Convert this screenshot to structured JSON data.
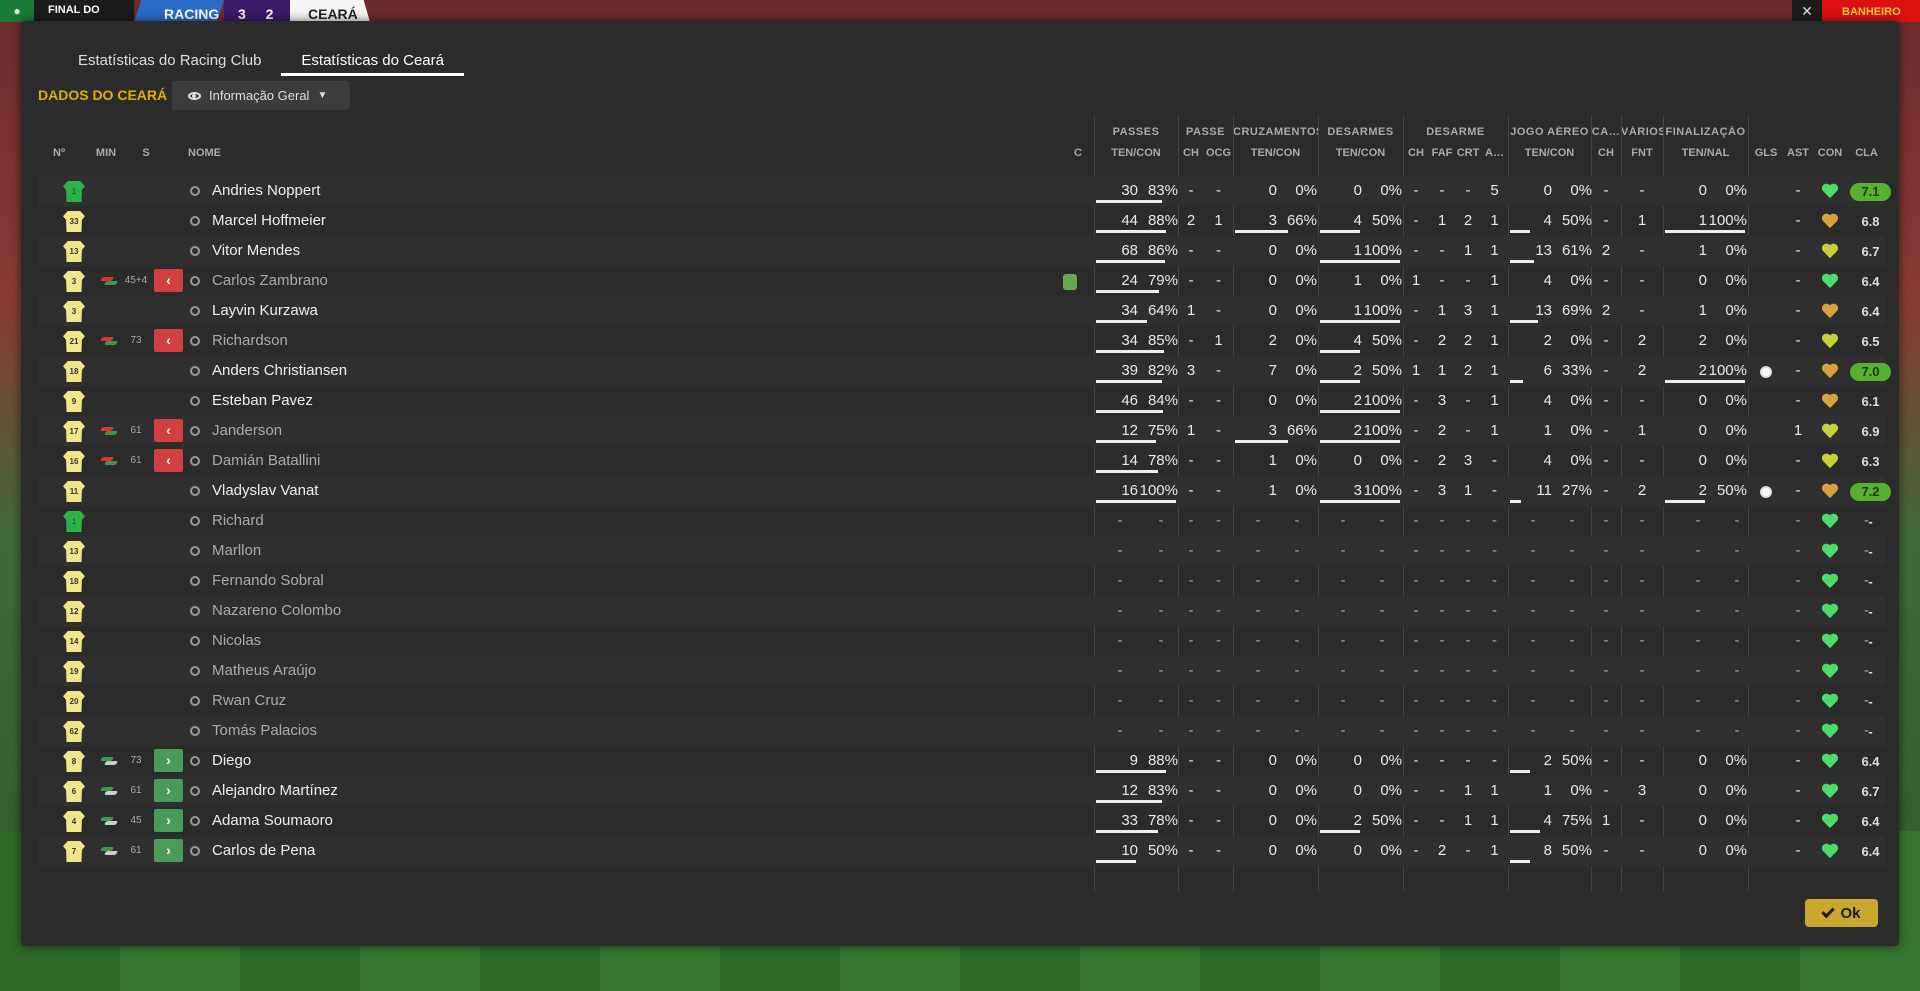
{
  "scorebar": {
    "stage": "FINAL DO",
    "home": "RACING",
    "score": "3 2",
    "away": "CEARÁ",
    "right_label": "BANHEIRO"
  },
  "tabs": [
    {
      "label": "Estatísticas do Racing Club",
      "active": false
    },
    {
      "label": "Estatísticas do Ceará",
      "active": true
    }
  ],
  "section_label": "DADOS DO CEARÁ",
  "view_select": "Informação Geral",
  "ok_label": "Ok",
  "group_headers": [
    "PASSES",
    "PASSE",
    "CRUZAMENTOS",
    "DESARMES",
    "DESARME",
    "JOGO AÉREO",
    "CA…",
    "VÁRIOS",
    "FINALIZAÇÃO"
  ],
  "column_headers": [
    "Nº",
    "MIN",
    "S",
    "NOME",
    "C",
    "TEN/CON",
    "CH",
    "OCG",
    "TEN/CON",
    "TEN/CON",
    "CH",
    "FAF",
    "CRT",
    "A…",
    "TEN/CON",
    "CH",
    "FNT",
    "TEN/NAL",
    "GLS",
    "AST",
    "CON",
    "CLA"
  ],
  "colors": {
    "accent": "#e0b000",
    "ok": "#c9a830",
    "sub_out": "#d04040",
    "sub_in": "#4a9a5a",
    "best_rating": "#58b030"
  },
  "players": [
    {
      "num": "1",
      "gk": true,
      "sub": "",
      "min": "",
      "name": "Andries Noppert",
      "pas": [
        "30",
        "83%"
      ],
      "pasf": 0.83,
      "pch": "-",
      "ocg": "-",
      "cru": [
        "0",
        "0%"
      ],
      "cruf": 0,
      "des": [
        "0",
        "0%"
      ],
      "desf": 0,
      "dch": "-",
      "faf": "-",
      "crt": "-",
      "a": "5",
      "air": [
        "0",
        "0%"
      ],
      "airf": 0,
      "ca": "-",
      "fnt": "-",
      "fin": [
        "0",
        "0%"
      ],
      "finf": 0,
      "gls": "",
      "ast": "-",
      "con": "green",
      "cla": "7.1",
      "best": true,
      "dim": false
    },
    {
      "num": "33",
      "gk": false,
      "sub": "",
      "min": "",
      "name": "Marcel Hoffmeier",
      "pas": [
        "44",
        "88%"
      ],
      "pasf": 0.88,
      "pch": "2",
      "ocg": "1",
      "cru": [
        "3",
        "66%"
      ],
      "cruf": 0.66,
      "des": [
        "4",
        "50%"
      ],
      "desf": 0.5,
      "dch": "-",
      "faf": "1",
      "crt": "2",
      "a": "1",
      "air": [
        "4",
        "50%"
      ],
      "airf": 0.5,
      "ca": "-",
      "fnt": "1",
      "fin": [
        "1",
        "100%"
      ],
      "finf": 1,
      "gls": "",
      "ast": "-",
      "con": "orange",
      "cla": "6.8",
      "best": false,
      "dim": false
    },
    {
      "num": "13",
      "gk": false,
      "sub": "",
      "min": "",
      "name": "Vitor Mendes",
      "pas": [
        "68",
        "86%"
      ],
      "pasf": 0.86,
      "pch": "-",
      "ocg": "-",
      "cru": [
        "0",
        "0%"
      ],
      "cruf": 0,
      "des": [
        "1",
        "100%"
      ],
      "desf": 1,
      "dch": "-",
      "faf": "-",
      "crt": "1",
      "a": "1",
      "air": [
        "13",
        "61%"
      ],
      "airf": 0.61,
      "ca": "2",
      "fnt": "-",
      "fin": [
        "1",
        "0%"
      ],
      "finf": 0,
      "gls": "",
      "ast": "-",
      "con": "yellow",
      "cla": "6.7",
      "best": false,
      "dim": false
    },
    {
      "num": "3",
      "gk": false,
      "sub": "out",
      "min": "45+4",
      "name": "Carlos Zambrano",
      "pas": [
        "24",
        "79%"
      ],
      "pasf": 0.79,
      "pch": "-",
      "ocg": "-",
      "cru": [
        "0",
        "0%"
      ],
      "cruf": 0,
      "des": [
        "1",
        "0%"
      ],
      "desf": 0,
      "dch": "1",
      "faf": "-",
      "crt": "-",
      "a": "1",
      "air": [
        "4",
        "0%"
      ],
      "airf": 0,
      "ca": "-",
      "fnt": "-",
      "fin": [
        "0",
        "0%"
      ],
      "finf": 0,
      "gls": "",
      "ast": "-",
      "con": "green",
      "cla": "6.4",
      "best": false,
      "dim": true,
      "card": true
    },
    {
      "num": "3",
      "gk": false,
      "sub": "",
      "min": "",
      "name": "Layvin Kurzawa",
      "pas": [
        "34",
        "64%"
      ],
      "pasf": 0.64,
      "pch": "1",
      "ocg": "-",
      "cru": [
        "0",
        "0%"
      ],
      "cruf": 0,
      "des": [
        "1",
        "100%"
      ],
      "desf": 1,
      "dch": "-",
      "faf": "1",
      "crt": "3",
      "a": "1",
      "air": [
        "13",
        "69%"
      ],
      "airf": 0.69,
      "ca": "2",
      "fnt": "-",
      "fin": [
        "1",
        "0%"
      ],
      "finf": 0,
      "gls": "",
      "ast": "-",
      "con": "orange",
      "cla": "6.4",
      "best": false,
      "dim": false
    },
    {
      "num": "21",
      "gk": false,
      "sub": "out",
      "min": "73",
      "name": "Richardson",
      "pas": [
        "34",
        "85%"
      ],
      "pasf": 0.85,
      "pch": "-",
      "ocg": "1",
      "cru": [
        "2",
        "0%"
      ],
      "cruf": 0,
      "des": [
        "4",
        "50%"
      ],
      "desf": 0.5,
      "dch": "-",
      "faf": "2",
      "crt": "2",
      "a": "1",
      "air": [
        "2",
        "0%"
      ],
      "airf": 0,
      "ca": "-",
      "fnt": "2",
      "fin": [
        "2",
        "0%"
      ],
      "finf": 0,
      "gls": "",
      "ast": "-",
      "con": "yellow",
      "cla": "6.5",
      "best": false,
      "dim": true
    },
    {
      "num": "18",
      "gk": false,
      "sub": "",
      "min": "",
      "name": "Anders Christiansen",
      "pas": [
        "39",
        "82%"
      ],
      "pasf": 0.82,
      "pch": "3",
      "ocg": "-",
      "cru": [
        "7",
        "0%"
      ],
      "cruf": 0,
      "des": [
        "2",
        "50%"
      ],
      "desf": 0.5,
      "dch": "1",
      "faf": "1",
      "crt": "2",
      "a": "1",
      "air": [
        "6",
        "33%"
      ],
      "airf": 0.33,
      "ca": "-",
      "fnt": "2",
      "fin": [
        "2",
        "100%"
      ],
      "finf": 1,
      "gls": "ball",
      "ast": "-",
      "con": "orange",
      "cla": "7.0",
      "best": true,
      "dim": false
    },
    {
      "num": "9",
      "gk": false,
      "sub": "",
      "min": "",
      "name": "Esteban Pavez",
      "pas": [
        "46",
        "84%"
      ],
      "pasf": 0.84,
      "pch": "-",
      "ocg": "-",
      "cru": [
        "0",
        "0%"
      ],
      "cruf": 0,
      "des": [
        "2",
        "100%"
      ],
      "desf": 1,
      "dch": "-",
      "faf": "3",
      "crt": "-",
      "a": "1",
      "air": [
        "4",
        "0%"
      ],
      "airf": 0,
      "ca": "-",
      "fnt": "-",
      "fin": [
        "0",
        "0%"
      ],
      "finf": 0,
      "gls": "",
      "ast": "-",
      "con": "orange",
      "cla": "6.1",
      "best": false,
      "dim": false
    },
    {
      "num": "17",
      "gk": false,
      "sub": "out",
      "min": "61",
      "name": "Janderson",
      "pas": [
        "12",
        "75%"
      ],
      "pasf": 0.75,
      "pch": "1",
      "ocg": "-",
      "cru": [
        "3",
        "66%"
      ],
      "cruf": 0.66,
      "des": [
        "2",
        "100%"
      ],
      "desf": 1,
      "dch": "-",
      "faf": "2",
      "crt": "-",
      "a": "1",
      "air": [
        "1",
        "0%"
      ],
      "airf": 0,
      "ca": "-",
      "fnt": "1",
      "fin": [
        "0",
        "0%"
      ],
      "finf": 0,
      "gls": "",
      "ast": "1",
      "con": "yellow",
      "cla": "6.9",
      "best": false,
      "dim": true
    },
    {
      "num": "16",
      "gk": false,
      "sub": "out",
      "min": "61",
      "name": "Damián Batallini",
      "pas": [
        "14",
        "78%"
      ],
      "pasf": 0.78,
      "pch": "-",
      "ocg": "-",
      "cru": [
        "1",
        "0%"
      ],
      "cruf": 0,
      "des": [
        "0",
        "0%"
      ],
      "desf": 0,
      "dch": "-",
      "faf": "2",
      "crt": "3",
      "a": "-",
      "air": [
        "4",
        "0%"
      ],
      "airf": 0,
      "ca": "-",
      "fnt": "-",
      "fin": [
        "0",
        "0%"
      ],
      "finf": 0,
      "gls": "",
      "ast": "-",
      "con": "yellow",
      "cla": "6.3",
      "best": false,
      "dim": true
    },
    {
      "num": "11",
      "gk": false,
      "sub": "",
      "min": "",
      "name": "Vladyslav Vanat",
      "pas": [
        "16",
        "100%"
      ],
      "pasf": 1,
      "pch": "-",
      "ocg": "-",
      "cru": [
        "1",
        "0%"
      ],
      "cruf": 0,
      "des": [
        "3",
        "100%"
      ],
      "desf": 1,
      "dch": "-",
      "faf": "3",
      "crt": "1",
      "a": "-",
      "air": [
        "11",
        "27%"
      ],
      "airf": 0.27,
      "ca": "-",
      "fnt": "2",
      "fin": [
        "2",
        "50%"
      ],
      "finf": 0.5,
      "gls": "ball",
      "ast": "-",
      "con": "orange",
      "cla": "7.2",
      "best": true,
      "dim": false
    },
    {
      "num": "1",
      "gk": true,
      "sub": "",
      "min": "",
      "name": "Richard",
      "empty": true,
      "con": "green",
      "dim": true
    },
    {
      "num": "13",
      "gk": false,
      "sub": "",
      "min": "",
      "name": "Marllon",
      "empty": true,
      "con": "green",
      "dim": true
    },
    {
      "num": "18",
      "gk": false,
      "sub": "",
      "min": "",
      "name": "Fernando Sobral",
      "empty": true,
      "con": "green",
      "dim": true
    },
    {
      "num": "12",
      "gk": false,
      "sub": "",
      "min": "",
      "name": "Nazareno Colombo",
      "empty": true,
      "con": "green",
      "dim": true
    },
    {
      "num": "14",
      "gk": false,
      "sub": "",
      "min": "",
      "name": "Nicolas",
      "empty": true,
      "con": "green",
      "dim": true
    },
    {
      "num": "19",
      "gk": false,
      "sub": "",
      "min": "",
      "name": "Matheus Araújo",
      "empty": true,
      "con": "green",
      "dim": true
    },
    {
      "num": "20",
      "gk": false,
      "sub": "",
      "min": "",
      "name": "Rwan Cruz",
      "empty": true,
      "con": "green",
      "dim": true
    },
    {
      "num": "62",
      "gk": false,
      "sub": "",
      "min": "",
      "name": "Tomás Palacios",
      "empty": true,
      "con": "green",
      "dim": true
    },
    {
      "num": "8",
      "gk": false,
      "sub": "in",
      "min": "73",
      "name": "Diego",
      "pas": [
        "9",
        "88%"
      ],
      "pasf": 0.88,
      "pch": "-",
      "ocg": "-",
      "cru": [
        "0",
        "0%"
      ],
      "cruf": 0,
      "des": [
        "0",
        "0%"
      ],
      "desf": 0,
      "dch": "-",
      "faf": "-",
      "crt": "-",
      "a": "-",
      "air": [
        "2",
        "50%"
      ],
      "airf": 0.5,
      "ca": "-",
      "fnt": "-",
      "fin": [
        "0",
        "0%"
      ],
      "finf": 0,
      "gls": "",
      "ast": "-",
      "con": "green",
      "cla": "6.4",
      "best": false,
      "dim": false
    },
    {
      "num": "6",
      "gk": false,
      "sub": "in",
      "min": "61",
      "name": "Alejandro Martínez",
      "pas": [
        "12",
        "83%"
      ],
      "pasf": 0.83,
      "pch": "-",
      "ocg": "-",
      "cru": [
        "0",
        "0%"
      ],
      "cruf": 0,
      "des": [
        "0",
        "0%"
      ],
      "desf": 0,
      "dch": "-",
      "faf": "-",
      "crt": "1",
      "a": "1",
      "air": [
        "1",
        "0%"
      ],
      "airf": 0,
      "ca": "-",
      "fnt": "3",
      "fin": [
        "0",
        "0%"
      ],
      "finf": 0,
      "gls": "",
      "ast": "-",
      "con": "green",
      "cla": "6.7",
      "best": false,
      "dim": false
    },
    {
      "num": "4",
      "gk": false,
      "sub": "in",
      "min": "45",
      "name": "Adama Soumaoro",
      "pas": [
        "33",
        "78%"
      ],
      "pasf": 0.78,
      "pch": "-",
      "ocg": "-",
      "cru": [
        "0",
        "0%"
      ],
      "cruf": 0,
      "des": [
        "2",
        "50%"
      ],
      "desf": 0.5,
      "dch": "-",
      "faf": "-",
      "crt": "1",
      "a": "1",
      "air": [
        "4",
        "75%"
      ],
      "airf": 0.75,
      "ca": "1",
      "fnt": "-",
      "fin": [
        "0",
        "0%"
      ],
      "finf": 0,
      "gls": "",
      "ast": "-",
      "con": "green",
      "cla": "6.4",
      "best": false,
      "dim": false
    },
    {
      "num": "7",
      "gk": false,
      "sub": "in",
      "min": "61",
      "name": "Carlos de Pena",
      "pas": [
        "10",
        "50%"
      ],
      "pasf": 0.5,
      "pch": "-",
      "ocg": "-",
      "cru": [
        "0",
        "0%"
      ],
      "cruf": 0,
      "des": [
        "0",
        "0%"
      ],
      "desf": 0,
      "dch": "-",
      "faf": "2",
      "crt": "-",
      "a": "1",
      "air": [
        "8",
        "50%"
      ],
      "airf": 0.5,
      "ca": "-",
      "fnt": "-",
      "fin": [
        "0",
        "0%"
      ],
      "finf": 0,
      "gls": "",
      "ast": "-",
      "con": "green",
      "cla": "6.4",
      "best": false,
      "dim": false
    }
  ]
}
